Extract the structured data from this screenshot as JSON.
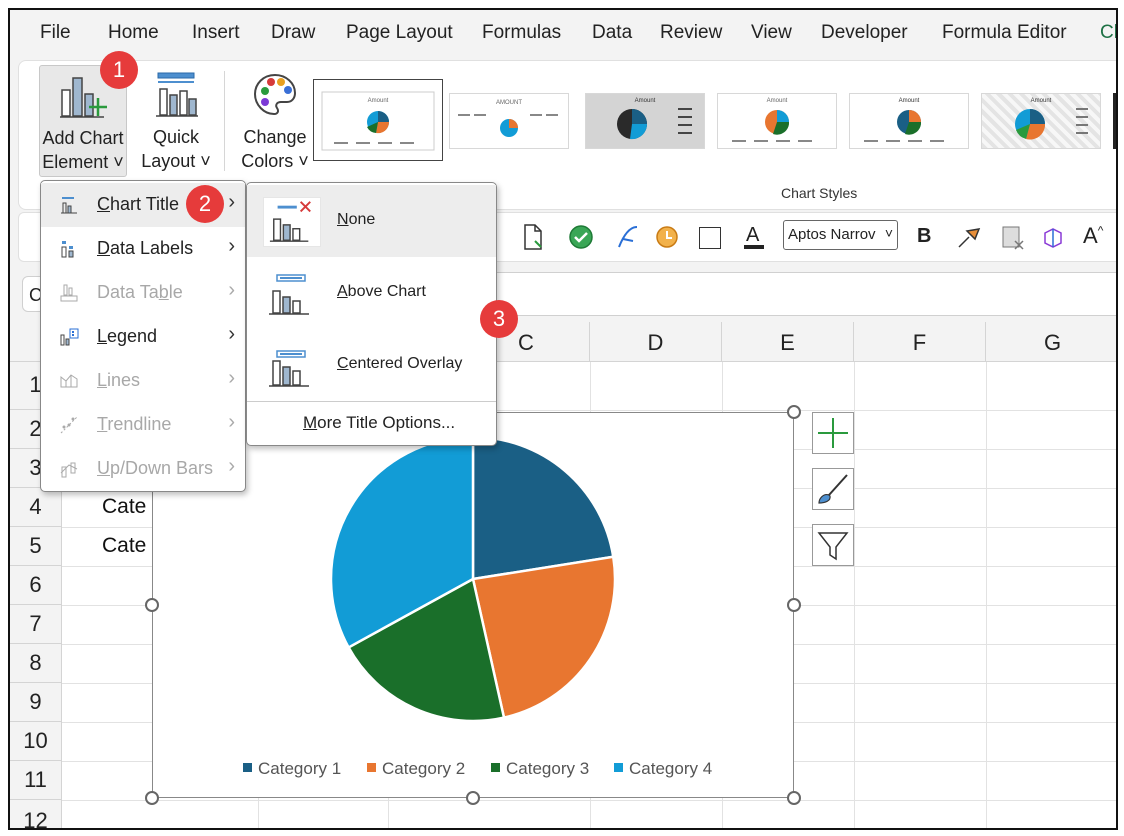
{
  "menubar": [
    "File",
    "Home",
    "Insert",
    "Draw",
    "Page Layout",
    "Formulas",
    "Data",
    "Review",
    "View",
    "Developer",
    "Formula Editor",
    "Ch"
  ],
  "ribbon": {
    "add_chart_element": [
      "Add Chart",
      "Element ˅"
    ],
    "quick_layout": [
      "Quick",
      "Layout ˅"
    ],
    "change_colors": [
      "Change",
      "Colors ˅"
    ],
    "chart_styles_label": "Chart Styles",
    "style_thumb_titles": [
      "Amount",
      "AMOUNT",
      "Amount",
      "Amount",
      "Amount",
      "Amount"
    ]
  },
  "format_toolbar": {
    "font_name": "Aptos Narrov"
  },
  "namebox_text": "C",
  "grid": {
    "columns": [
      "C",
      "D",
      "E",
      "F",
      "G"
    ],
    "rows": [
      "1",
      "2",
      "3",
      "4",
      "5",
      "6",
      "7",
      "8",
      "9",
      "10",
      "11",
      "12"
    ],
    "cells": {
      "A4": "Cate",
      "A5": "Cate"
    }
  },
  "menu1": {
    "items": [
      {
        "label": "Chart Title",
        "accel": "C",
        "rest": "hart Title",
        "enabled": true
      },
      {
        "label": "Data Labels",
        "accel": "D",
        "rest": "ata Labels",
        "enabled": true
      },
      {
        "label": "Data Table",
        "pre": "Data Ta",
        "accel": "b",
        "rest": "le",
        "enabled": false
      },
      {
        "label": "Legend",
        "accel": "L",
        "rest": "egend",
        "enabled": true
      },
      {
        "label": "Lines",
        "accel": "L",
        "rest": "ines",
        "enabled": false
      },
      {
        "label": "Trendline",
        "accel": "T",
        "rest": "rendline",
        "enabled": false
      },
      {
        "label": "Up/Down Bars",
        "accel": "U",
        "rest": "p/Down Bars",
        "enabled": false
      }
    ]
  },
  "menu2": {
    "items": [
      {
        "label": "None",
        "accel": "N",
        "rest": "one"
      },
      {
        "label": "Above Chart",
        "accel": "A",
        "rest": "bove Chart"
      },
      {
        "label": "Centered Overlay",
        "accel": "C",
        "rest": "entered Overlay"
      }
    ],
    "more": {
      "accel": "M",
      "rest": "ore Title Options..."
    }
  },
  "badges": [
    "1",
    "2",
    "3"
  ],
  "colors": {
    "cat1": "#1a5f85",
    "cat2": "#e87630",
    "cat3": "#1a6f2a",
    "cat4": "#129cd6",
    "badge": "#e63b3b",
    "accent_green": "#1e7145"
  },
  "chart_data": {
    "type": "pie",
    "title": "",
    "categories": [
      "Category 1",
      "Category 2",
      "Category 3",
      "Category 4"
    ],
    "values": [
      22.5,
      24.0,
      20.5,
      33.0
    ],
    "legend": "bottom"
  }
}
